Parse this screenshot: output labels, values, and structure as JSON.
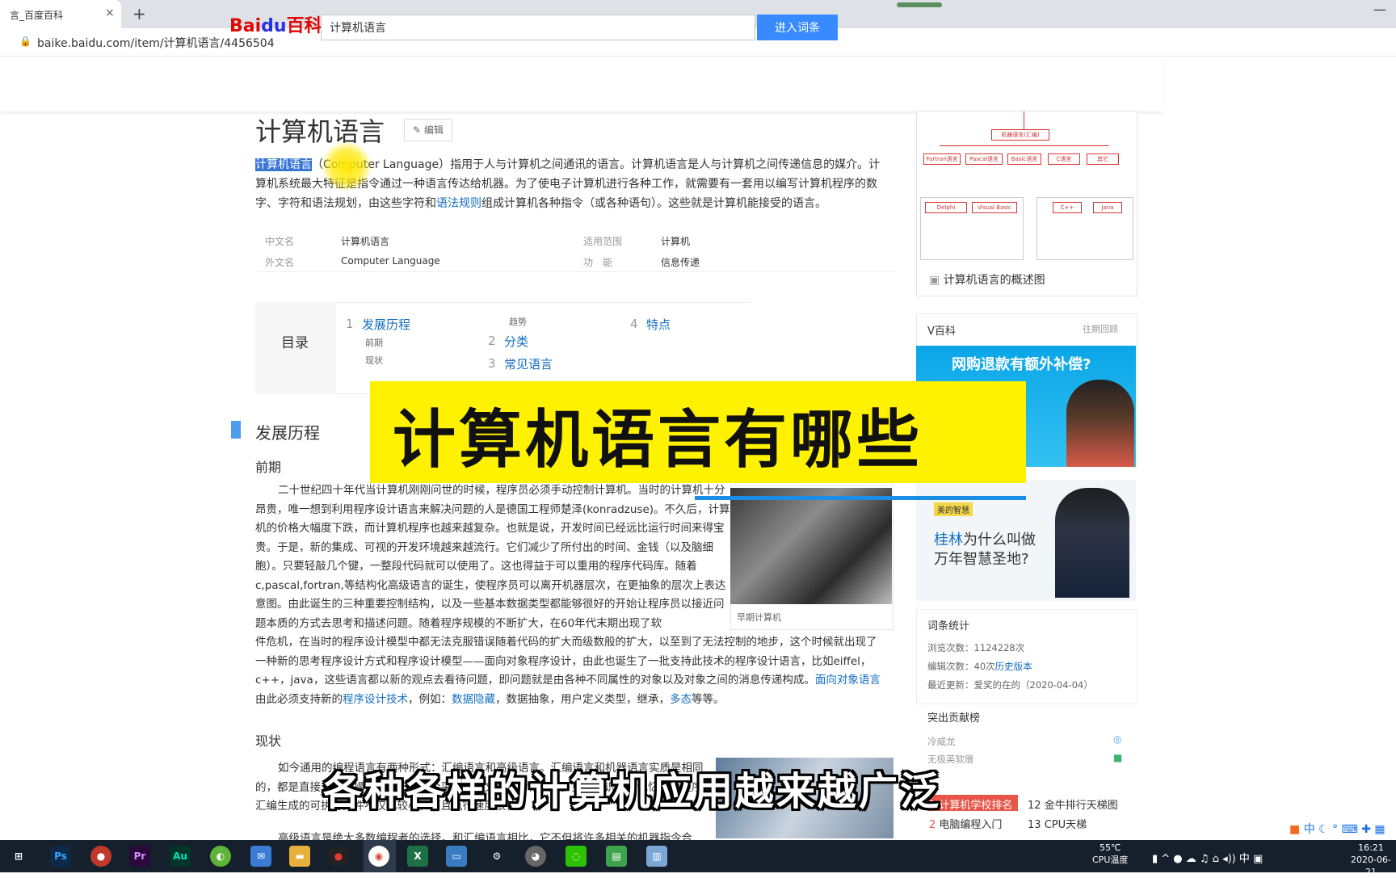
{
  "browser": {
    "tab_title": "言_百度百科",
    "close_glyph": "×",
    "new_tab_glyph": "+",
    "url": "baike.baidu.com/item/计算机语言/4456504"
  },
  "header": {
    "logo_bai": "Bai",
    "logo_du": "du",
    "logo_baike": "百科",
    "search_value": "计算机语言",
    "search_button": "进入词条"
  },
  "article": {
    "title": "计算机语言",
    "edit_label": "编辑",
    "intro_highlight": "计算机语言",
    "intro_part1": "（Computer Language）指用于人与计算机之间通讯的语言。计算机语言是人与计算机之间传递信息的媒介。计算机系统最大特征是指令通过一种语言传达给机器。为了使电子计算机进行各种工作，就需要有一套用以编写计算机程序的数字、字符和语法规划，由这些字符和",
    "intro_link": "语法规则",
    "intro_part2": "组成计算机各种指令（或各种语句）。这些就是计算机能接受的语言。",
    "basic_info": [
      {
        "label": "中文名",
        "value": "计算机语言"
      },
      {
        "label": "适用范围",
        "value": "计算机"
      },
      {
        "label": "外文名",
        "value": "Computer Language"
      },
      {
        "label": "功　能",
        "value": "信息传递"
      }
    ],
    "toc_title": "目录",
    "toc": [
      {
        "num": "1",
        "label": "发展历程"
      },
      {
        "num": "2",
        "label": "分类"
      },
      {
        "num": "3",
        "label": "常见语言"
      },
      {
        "num": "4",
        "label": "特点"
      }
    ],
    "toc_subs": [
      "前期",
      "现状",
      "趋势"
    ],
    "section_title": "发展历程",
    "sub1": "前期",
    "para1": "二十世纪四十年代当计算机刚刚问世的时候，程序员必须手动控制计算机。当时的计算机十分昂贵，唯一想到利用程序设计语言来解决问题的人是德国工程师楚泽(konradzuse)。不久后，计算机的价格大幅度下跌，而计算机程序也越来越复杂。也就是说，开发时间已经远比运行时间来得宝贵。于是，新的集成、可视的开发环境越来越流行。它们减少了所付出的时间、金钱（以及脑细胞）。只要轻敲几个键，一整段代码就可以使用了。这也得益于可以重用的程序代码库。随着c,pascal,fortran,等结构化高级语言的诞生，使程序员可以离开机器层次，在更抽象的层次上表达意图。由此诞生的三种重要控制结构，以及一些基本数据类型都能够很好的开始让程序员以接近问题本质的方式去思考和描述问题。随着程序规模的不断扩大，在60年代末期出现了软",
    "para1b_text": "件危机，在当时的程序设计模型中都无法克服错误随着代码的扩大而级数般的扩大，以至到了无法控制的地步，这个时候就出现了一种新的思考程序设计方式和程序设计模型——面向对象程序设计，由此也诞生了一批支持此技术的程序设计语言，比如eiffel，c++，java，这些语言都以新的观点去看待问题，即问题就是由各种不同属性的对象以及对象之间的消息传递构成。",
    "para1b_link1": "面向对象语言",
    "para1b_mid": "由此必须支持新的",
    "para1b_link2": "程序设计技术",
    "para1b_mid2": "，例如：",
    "para1b_link3": "数据隐藏",
    "para1b_mid3": "，数据抽象，用户定义类型，继承，",
    "para1b_link4": "多态",
    "para1b_end": "等等。",
    "photo_caption": "早期计算机",
    "sub2": "现状",
    "para2": "如今通用的编程语言有两种形式：汇编语言和高级语言。汇编语言和机器语言实质是相同的，都是直接对硬件操作，只不过指令采用了英文缩写的标识符，更容易识别和记忆。源程序经汇编生成的可执行文件不仅比较小，而且执行速度很快。",
    "para3": "高级语言是绝大多数编程者的选择。和汇编语言相比，它不但将许多相关的机器指令合"
  },
  "sidebar": {
    "diagram_caption": "计算机语言的概述图",
    "diagram_nodes": [
      "机器语言(汇编)",
      "Fortran语言",
      "Pascal语言",
      "Basic语言",
      "C语言",
      "其它",
      "Delphi",
      "Visual Basic",
      "C++",
      "Java"
    ],
    "vbaike_title": "V百科",
    "vbaike_more": "往期回顾",
    "vbaike_banner": "网购退款有额外补偿?",
    "ad_brand": "美的智慧",
    "ad_highlight": "桂林",
    "ad_line1": "为什么叫做",
    "ad_line2": "万年智慧圣地?",
    "stats_title": "词条统计",
    "stats": [
      {
        "label": "浏览次数：",
        "value": "1124228次"
      },
      {
        "label": "编辑次数：",
        "value": "40次",
        "link": "历史版本"
      },
      {
        "label": "最近更新：",
        "value": "爱奖的在的（2020-04-04）"
      }
    ],
    "contrib_title": "突出贡献榜",
    "contributors": [
      "冷威龙",
      "无极英软厝"
    ],
    "rank_items": [
      {
        "num": "1",
        "label": "计算机学校排名"
      },
      {
        "num": "12",
        "label": "金牛排行天梯图"
      },
      {
        "num": "2",
        "label": "电脑编程入门"
      },
      {
        "num": "13",
        "label": "CPU天梯"
      }
    ]
  },
  "overlay": {
    "banner_text": "计算机语言有哪些",
    "subtitle": "各种各样的计算机应用越来越广泛"
  },
  "ime": "中",
  "taskbar": {
    "icons": [
      "task-view-icon",
      "photoshop-icon",
      "app-icon",
      "premiere-icon",
      "audition-icon",
      "app2-icon",
      "mail-icon",
      "folder-icon",
      "record-icon",
      "chrome-icon",
      "excel-icon",
      "monitor-icon",
      "settings-icon",
      "app3-icon",
      "wechat-icon",
      "app4-icon",
      "app5-icon"
    ],
    "cpu_temp": "55℃",
    "cpu_label": "CPU温度",
    "ime": "中",
    "time": "16:21",
    "date": "2020-06-21"
  },
  "colors": {
    "baidu_red": "#e10601",
    "baidu_blue": "#2932e1",
    "link": "#136ec2",
    "search_button": "#388bff",
    "banner_yellow": "#fff200"
  }
}
